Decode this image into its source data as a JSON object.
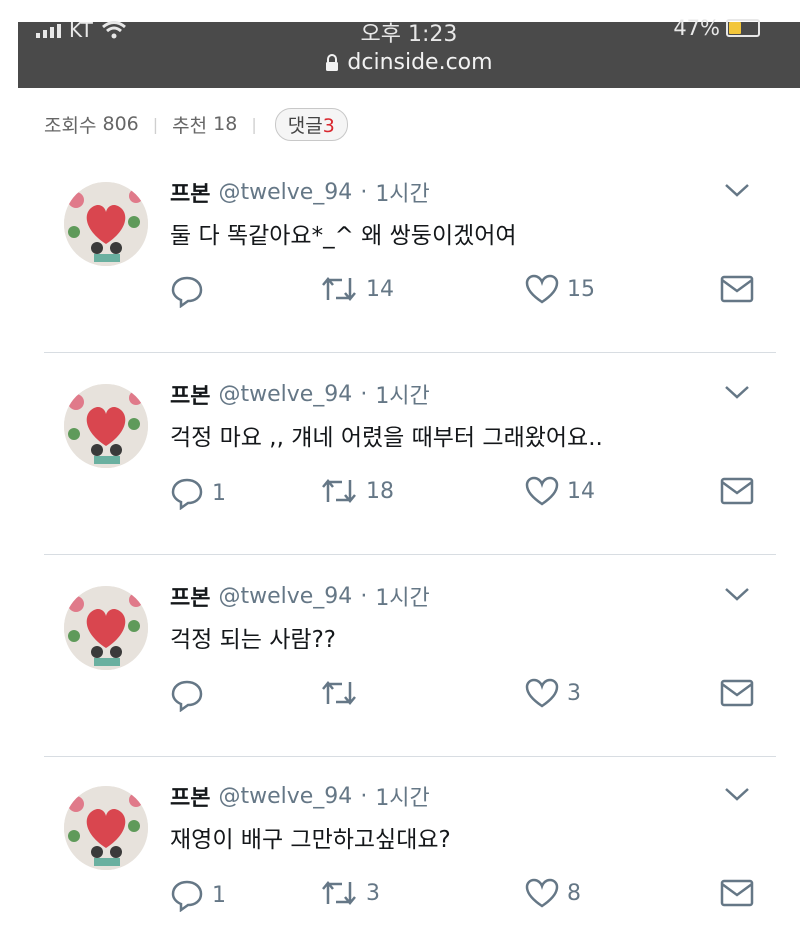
{
  "statusbar": {
    "carrier": "KT",
    "time": "오후 1:23",
    "battery": "47%",
    "battery_level": 0.47,
    "url": "dcinside.com"
  },
  "post_meta": {
    "views_label": "조회수",
    "views": "806",
    "recommend_label": "추천",
    "recommends": "18",
    "comments_label": "댓글",
    "comments": "3"
  },
  "tweets": [
    {
      "name": "프본",
      "handle": "@twelve_94",
      "dot": "·",
      "time": "1시간",
      "text": "둘 다 똑같아요*_^ 왜 쌍둥이겠어여",
      "reply": "",
      "retweet": "14",
      "like": "15"
    },
    {
      "name": "프본",
      "handle": "@twelve_94",
      "dot": "·",
      "time": "1시간",
      "text": "걱정 마요 ,, 걔네 어렸을 때부터 그래왔어요..",
      "reply": "1",
      "retweet": "18",
      "like": "14"
    },
    {
      "name": "프본",
      "handle": "@twelve_94",
      "dot": "·",
      "time": "1시간",
      "text": "걱정 되는 사람??",
      "reply": "",
      "retweet": "",
      "like": "3"
    },
    {
      "name": "프본",
      "handle": "@twelve_94",
      "dot": "·",
      "time": "1시간",
      "text": "재영이 배구 그만하고싶대요?",
      "reply": "1",
      "retweet": "3",
      "like": "8"
    }
  ],
  "icons": {
    "lock": "lock-icon",
    "wifi": "wifi-icon",
    "signal": "signal-icon",
    "battery": "battery-icon",
    "reply": "reply-icon",
    "retweet": "retweet-icon",
    "like": "heart-icon",
    "dm": "mail-icon",
    "caret": "chevron-down-icon"
  },
  "colors": {
    "statusbar_bg": "#4a4a4a",
    "comment_count": "#d9272e",
    "muted": "#657786"
  }
}
